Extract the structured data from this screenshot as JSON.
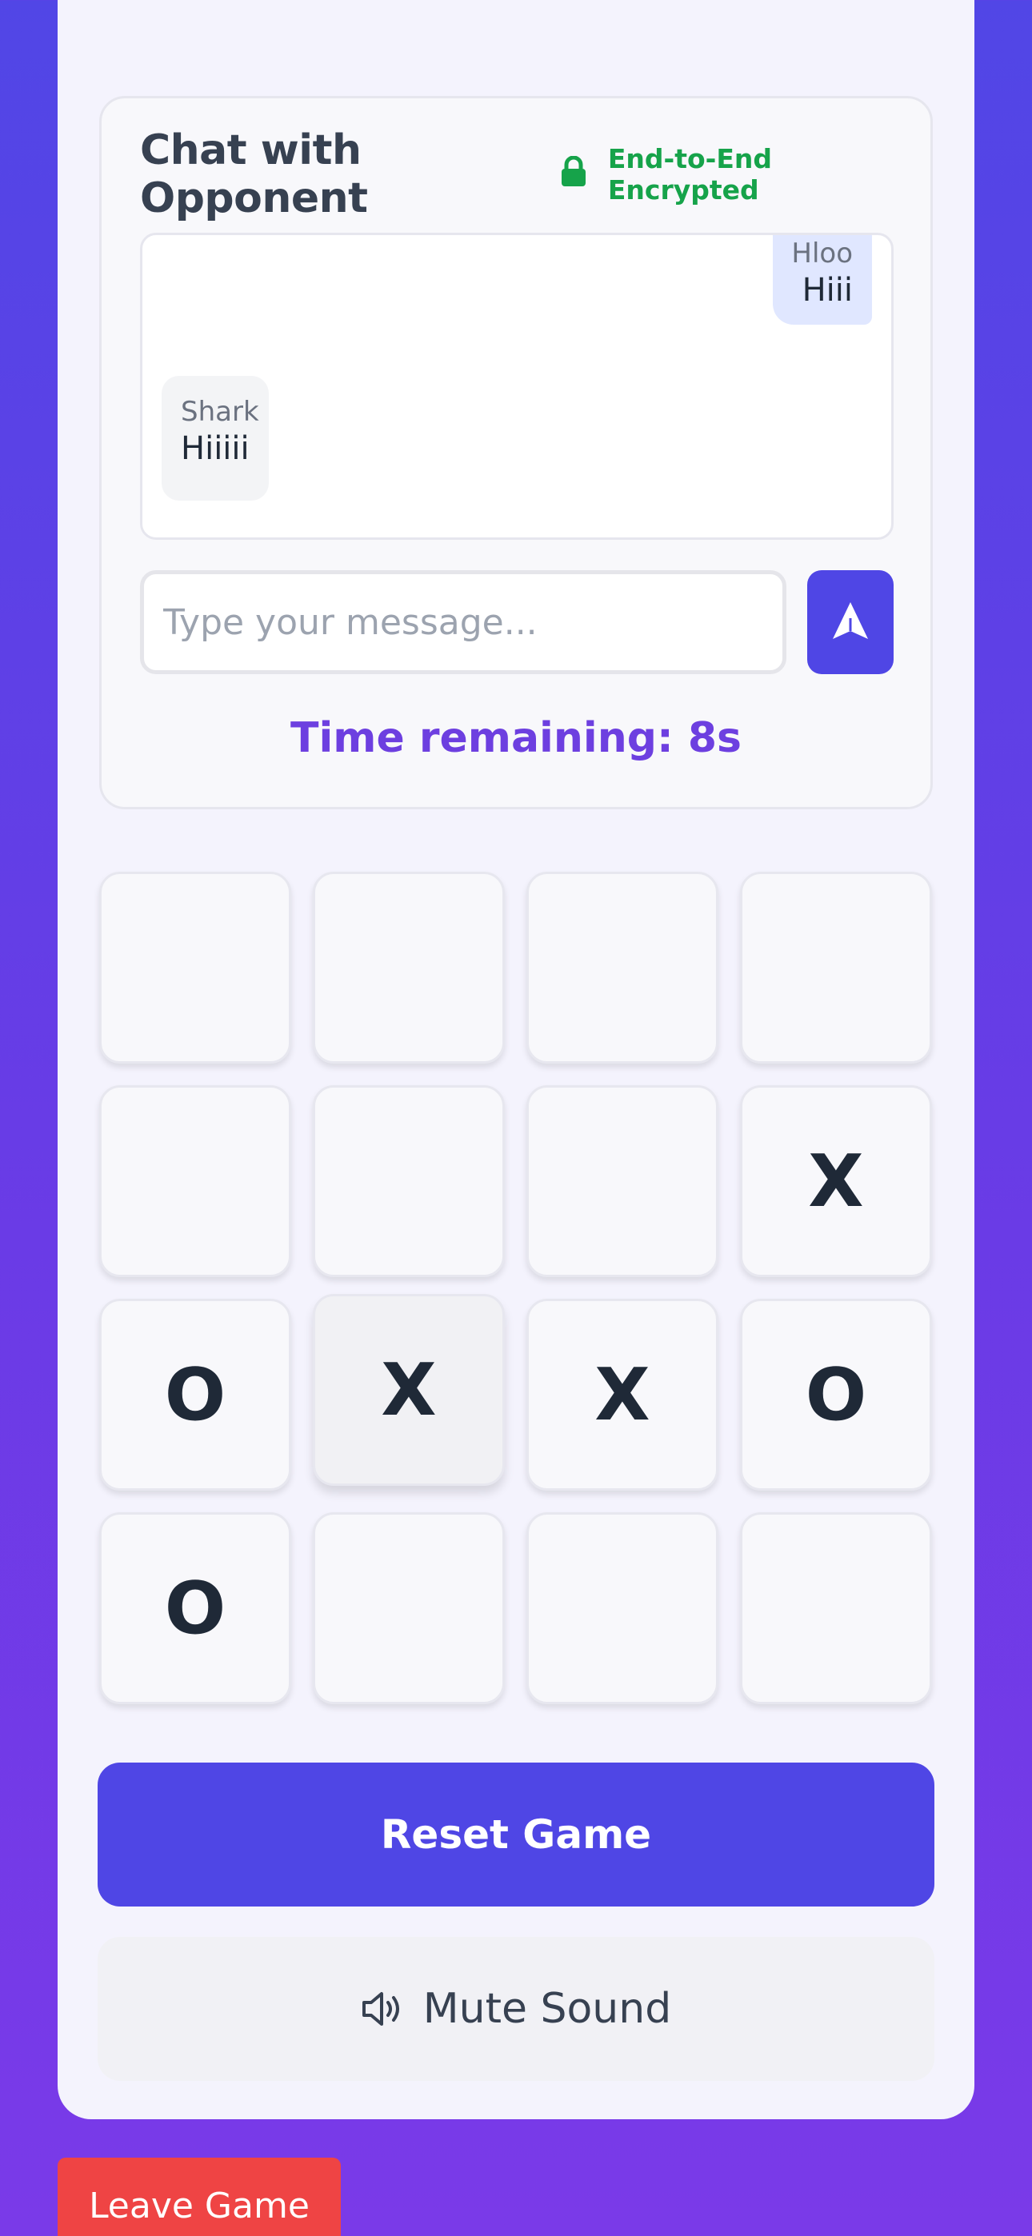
{
  "chat": {
    "title": "Chat with Opponent",
    "encryption_label": "End-to-End Encrypted",
    "messages": [
      {
        "user": "Hloo",
        "text": "Hiii",
        "side": "mine"
      },
      {
        "user": "Shark",
        "text": "Hiiiii",
        "side": "theirs"
      }
    ],
    "input_placeholder": "Type your message...",
    "timer": "Time remaining: 8s"
  },
  "board": {
    "cells": [
      "",
      "",
      "",
      "",
      "",
      "",
      "",
      "X",
      "O",
      "X",
      "X",
      "O",
      "O",
      "",
      "",
      ""
    ]
  },
  "buttons": {
    "reset": "Reset Game",
    "mute": "Mute Sound",
    "leave": "Leave Game"
  },
  "colors": {
    "primary": "#4f46e5",
    "encrypted": "#16a34a",
    "timer": "#6d3fe0",
    "danger": "#ef4444"
  },
  "icons": {
    "lock": "lock-icon",
    "send": "send-icon",
    "speaker": "speaker-icon"
  }
}
